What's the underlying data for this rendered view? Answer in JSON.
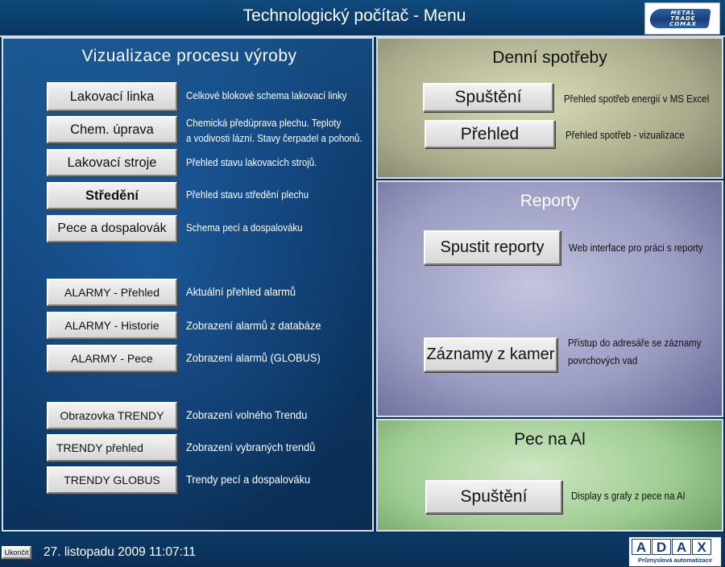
{
  "header": {
    "title": "Technologický počítač - Menu",
    "logo_lines": [
      "METAL",
      "TRADE",
      "COMAX"
    ]
  },
  "left": {
    "heading": "Vizualizace procesu výroby",
    "process": [
      {
        "label": "Lakovací linka",
        "desc": [
          "Celkové blokové schema lakovací linky"
        ]
      },
      {
        "label": "Chem. úprava",
        "desc": [
          "Chemická předúprava plechu. Teploty",
          "a vodivosti lázní. Stavy čerpadel a pohonů."
        ]
      },
      {
        "label": "Lakovací stroje",
        "desc": [
          "Přehled stavu lakovacích strojů."
        ]
      },
      {
        "label": "Středění",
        "desc": [
          "Přehled stavu středění plechu"
        ]
      },
      {
        "label": "Pece a dospalovák",
        "desc": [
          "Schema pecí a dospalováku"
        ]
      }
    ],
    "alarms": [
      {
        "label": "ALARMY - Přehled",
        "desc": [
          "Aktuální přehled alarmů"
        ]
      },
      {
        "label": "ALARMY - Historie",
        "desc": [
          "Zobrazení alarmů z databáze"
        ]
      },
      {
        "label": "ALARMY - Pece",
        "desc": [
          "Zobrazení alarmů (GLOBUS)"
        ]
      }
    ],
    "trends": [
      {
        "label": "Obrazovka TRENDY",
        "desc": [
          "Zobrazení volného Trendu"
        ]
      },
      {
        "label": "TRENDY přehled",
        "desc": [
          "Zobrazení vybraných trendů"
        ]
      },
      {
        "label": "TRENDY GLOBUS",
        "desc": [
          "Trendy pecí a dospalováku"
        ]
      }
    ]
  },
  "denni": {
    "heading": "Denní spotřeby",
    "items": [
      {
        "label": "Spuštění",
        "desc": [
          "Přehled spotřeb energií v MS Excel"
        ]
      },
      {
        "label": "Přehled",
        "desc": [
          "Přehled spotřeb - vizualizace"
        ]
      }
    ]
  },
  "reporty": {
    "heading": "Reporty",
    "items": [
      {
        "label": "Spustit reporty",
        "desc": [
          "Web interface pro práci s reporty"
        ]
      },
      {
        "label": "Záznamy z kamer",
        "desc": [
          "Přístup do adresáře se záznamy",
          "povrchových vad"
        ]
      }
    ]
  },
  "pec": {
    "heading": "Pec na Al",
    "items": [
      {
        "label": "Spuštění",
        "desc": [
          "Display s grafy z pece na Al"
        ]
      }
    ]
  },
  "footer": {
    "exit_label": "Ukončit",
    "datetime": "27. listopadu 2009 11:07:11",
    "adax_letters": [
      "A",
      "D",
      "A",
      "X"
    ],
    "adax_tagline": "Průmyslová automatizace"
  }
}
